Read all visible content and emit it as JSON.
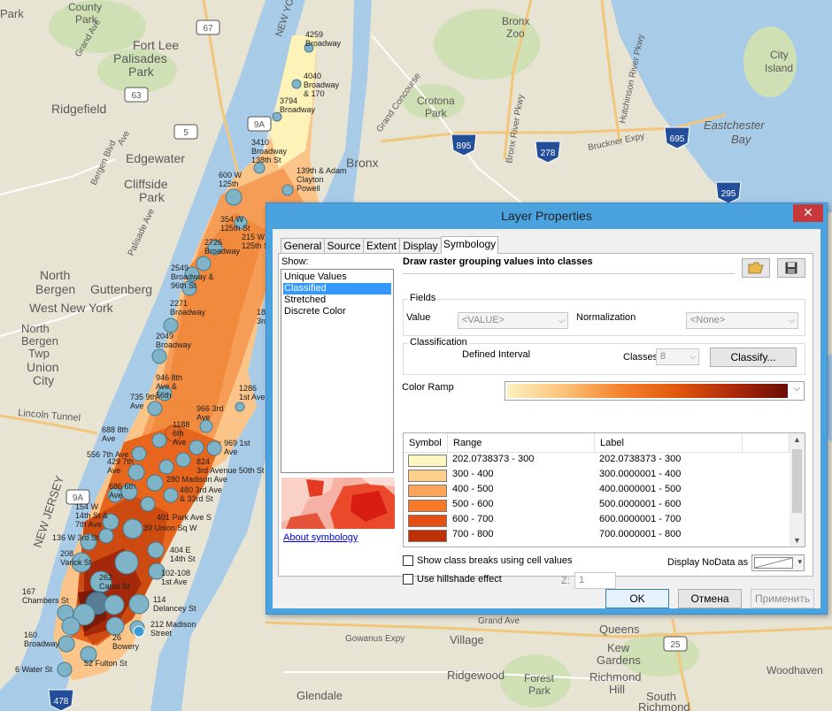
{
  "map": {
    "places": [
      {
        "text": "Park"
      },
      {
        "text": "County"
      },
      {
        "text": "Park"
      },
      {
        "text": "Fort Lee"
      },
      {
        "text": "Palisades"
      },
      {
        "text": "Park"
      },
      {
        "text": "Ridgefield"
      },
      {
        "text": "Edgewater"
      },
      {
        "text": "Cliffside"
      },
      {
        "text": "Park"
      },
      {
        "text": "North"
      },
      {
        "text": "Bergen"
      },
      {
        "text": "Guttenberg"
      },
      {
        "text": "West New York"
      },
      {
        "text": "North"
      },
      {
        "text": "Bergen"
      },
      {
        "text": "Twp"
      },
      {
        "text": "Union"
      },
      {
        "text": "City"
      },
      {
        "text": "Bronx"
      },
      {
        "text": "Bronx"
      },
      {
        "text": "Zoo"
      },
      {
        "text": "Crotona"
      },
      {
        "text": "Park"
      },
      {
        "text": "City"
      },
      {
        "text": "Island"
      },
      {
        "text": "Eastchester"
      },
      {
        "text": "Bay"
      },
      {
        "text": "Village"
      },
      {
        "text": "Queens"
      },
      {
        "text": "Kew"
      },
      {
        "text": "Gardens"
      },
      {
        "text": "Richmond"
      },
      {
        "text": "Hill"
      },
      {
        "text": "Ridgewood"
      },
      {
        "text": "Forest"
      },
      {
        "text": "Park"
      },
      {
        "text": "South"
      },
      {
        "text": "Richmond"
      },
      {
        "text": "Glendale"
      },
      {
        "text": "Woodhaven"
      }
    ],
    "roads": [
      "Grand Concourse",
      "Bronx River Pkwy",
      "Hutchinson River Pkwy",
      "Bruckner Expy",
      "Lincoln Tunnel",
      "Gowanus Expy",
      "Grand Ave",
      "Ave",
      "Bergen Blvd",
      "Palisade Ave",
      "NEW YORK",
      "NEW JERSEY",
      "Grand Ave"
    ],
    "shields": [
      "67",
      "63",
      "5",
      "9A",
      "895",
      "278",
      "695",
      "295",
      "9A",
      "478",
      "25"
    ],
    "sites": [
      {
        "lines": [
          "4259",
          "Broadway"
        ]
      },
      {
        "lines": [
          "4040",
          "Broadway",
          "& 170"
        ]
      },
      {
        "lines": [
          "3794",
          "Broadway"
        ]
      },
      {
        "lines": [
          "3410",
          "Broadway",
          "138th St"
        ]
      },
      {
        "lines": [
          "139th & Adam",
          "Clayton",
          "Powell"
        ]
      },
      {
        "lines": [
          "600 W",
          "125th"
        ]
      },
      {
        "lines": [
          "354 W",
          "125th St"
        ]
      },
      {
        "lines": [
          "215 W",
          "125th St"
        ]
      },
      {
        "lines": [
          "2726",
          "Broadway"
        ]
      },
      {
        "lines": [
          "2549",
          "Broadway &",
          "96th St"
        ]
      },
      {
        "lines": [
          "18",
          "3rd A"
        ]
      },
      {
        "lines": [
          "2271",
          "Broadway"
        ]
      },
      {
        "lines": [
          "2049",
          "Broadway"
        ]
      },
      {
        "lines": [
          "946 8th",
          "Ave &",
          "56th"
        ]
      },
      {
        "lines": [
          "1286",
          "1st Ave"
        ]
      },
      {
        "lines": [
          "966 3rd",
          "Ave"
        ]
      },
      {
        "lines": [
          "735 9th",
          "Ave"
        ]
      },
      {
        "lines": [
          "1188",
          "6th",
          "Ave"
        ]
      },
      {
        "lines": [
          "688 8th",
          "Ave"
        ]
      },
      {
        "lines": [
          "969 1st",
          "Ave"
        ]
      },
      {
        "lines": [
          "556 7th Ave"
        ]
      },
      {
        "lines": [
          "429 7th",
          "Ave"
        ]
      },
      {
        "lines": [
          "824",
          "3rd Avenue 50th St"
        ]
      },
      {
        "lines": [
          "280 Madison Ave"
        ]
      },
      {
        "lines": [
          "686 6th",
          "Ave"
        ]
      },
      {
        "lines": [
          "480 3rd Ave",
          "& 33rd St"
        ]
      },
      {
        "lines": [
          "154 W",
          "14th St &",
          "7th Ave"
        ]
      },
      {
        "lines": [
          "401 Park Ave S"
        ]
      },
      {
        "lines": [
          "39 Union Sq W"
        ]
      },
      {
        "lines": [
          "136 W 3rd St"
        ]
      },
      {
        "lines": [
          "208",
          "Varick St"
        ]
      },
      {
        "lines": [
          "404 E",
          "14th St"
        ]
      },
      {
        "lines": [
          "102-108",
          "1st Ave"
        ]
      },
      {
        "lines": [
          "262",
          "Canal St"
        ]
      },
      {
        "lines": [
          "167",
          "Chambers St"
        ]
      },
      {
        "lines": [
          "114",
          "Delancey St"
        ]
      },
      {
        "lines": [
          "212 Madison",
          "Street"
        ]
      },
      {
        "lines": [
          "160",
          "Broadway"
        ]
      },
      {
        "lines": [
          "26",
          "Bowery"
        ]
      },
      {
        "lines": [
          "52 Fulton St"
        ]
      },
      {
        "lines": [
          "6 Water St"
        ]
      }
    ]
  },
  "dialog": {
    "title": "Layer Properties",
    "close_glyph": "✕",
    "tabs": [
      "General",
      "Source",
      "Extent",
      "Display",
      "Symbology"
    ],
    "active_tab": "Symbology",
    "show_label": "Show:",
    "show_items": [
      "Unique Values",
      "Classified",
      "Stretched",
      "Discrete Color"
    ],
    "selected_show": "Classified",
    "about_link": "About symbology",
    "heading": "Draw raster grouping values into classes",
    "fields": {
      "group_label": "Fields",
      "value_label": "Value",
      "value_selected": "<VALUE>",
      "normalization_label": "Normalization",
      "normalization_selected": "<None>"
    },
    "classification": {
      "group_label": "Classification",
      "method": "Defined Interval",
      "classes_label": "Classes",
      "classes_value": "8",
      "classify_button": "Classify..."
    },
    "color_ramp_label": "Color Ramp",
    "table": {
      "headers": [
        "Symbol",
        "Range",
        "Label"
      ],
      "rows": [
        {
          "color": "#fef6c0",
          "range": "202.0738373 - 300",
          "label": "202.0738373 - 300"
        },
        {
          "color": "#fcd08a",
          "range": "300 - 400",
          "label": "300.0000001 - 400"
        },
        {
          "color": "#fba45a",
          "range": "400 - 500",
          "label": "400.0000001 - 500"
        },
        {
          "color": "#f7792a",
          "range": "500 - 600",
          "label": "500.0000001 - 600"
        },
        {
          "color": "#e55012",
          "range": "600 - 700",
          "label": "600.0000001 - 700"
        },
        {
          "color": "#bf3208",
          "range": "700 - 800",
          "label": "700.0000001 - 800"
        }
      ]
    },
    "show_breaks_label": "Show class breaks using cell values",
    "hillshade_label": "Use hillshade effect",
    "z_label": "Z:",
    "z_value": "1",
    "nodata_label": "Display NoData as",
    "ok_button": "OK",
    "cancel_button": "Отмена",
    "apply_button": "Применить"
  }
}
